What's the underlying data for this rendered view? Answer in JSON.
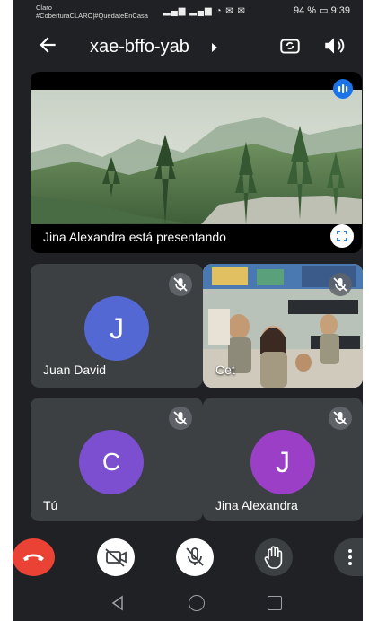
{
  "status_bar": {
    "carrier": "Claro",
    "hashtag": "#CoberturaCLARO|#QuedateEnCasa",
    "battery": "94 %",
    "time": "9:39"
  },
  "header": {
    "meeting_code": "xae-bffo-yab",
    "back_icon": "arrow-left-icon",
    "camera_switch_icon": "camera-switch-icon",
    "speaker_icon": "speaker-icon"
  },
  "presentation": {
    "caption": "Jina Alexandra está presentando"
  },
  "participants": [
    {
      "initial": "J",
      "name": "Juan David",
      "avatar_color": "#5468d4"
    },
    {
      "initial": "",
      "name": "Cet"
    },
    {
      "initial": "C",
      "name": "Tú",
      "avatar_color": "#7b4fd0"
    },
    {
      "initial": "J",
      "name": "Jina Alexandra",
      "avatar_color": "#9b3fc7"
    }
  ],
  "colors": {
    "hangup": "#ea4335",
    "tile_bg": "#3c4043",
    "app_bg": "#202124",
    "accent": "#1a73e8"
  },
  "controls": [
    "hang-up",
    "camera-off",
    "mic-off",
    "raise-hand",
    "more-options"
  ]
}
